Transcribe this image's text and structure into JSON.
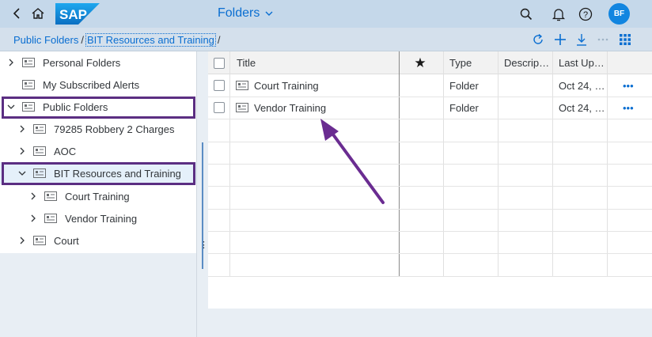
{
  "shell": {
    "logo_text": "SAP",
    "title": "Folders",
    "avatar_initials": "BF"
  },
  "breadcrumb": {
    "items": [
      "Public Folders",
      "BIT Resources and Training"
    ],
    "separator": "/"
  },
  "tree": {
    "items": [
      {
        "label": "Personal Folders",
        "expanded": false
      },
      {
        "label": "My Subscribed Alerts",
        "expanded": null
      },
      {
        "label": "Public Folders",
        "expanded": true
      },
      {
        "label": "79285 Robbery 2 Charges",
        "expanded": false
      },
      {
        "label": "AOC",
        "expanded": false
      },
      {
        "label": "BIT Resources and Training",
        "expanded": true
      },
      {
        "label": "Court Training",
        "expanded": false
      },
      {
        "label": "Vendor Training",
        "expanded": false
      },
      {
        "label": "Court",
        "expanded": false
      }
    ]
  },
  "table": {
    "columns": {
      "title": "Title",
      "favorite": "★",
      "type": "Type",
      "description": "Descrip…",
      "last_updated": "Last Up…"
    },
    "rows": [
      {
        "title": "Court Training",
        "type": "Folder",
        "last_updated": "Oct 24, …",
        "more": "•••"
      },
      {
        "title": "Vendor Training",
        "type": "Folder",
        "last_updated": "Oct 24, …",
        "more": "•••"
      }
    ]
  },
  "colors": {
    "accent": "#0a6ed1",
    "highlight_box": "#5b2e82",
    "arrow": "#6a2c91"
  }
}
